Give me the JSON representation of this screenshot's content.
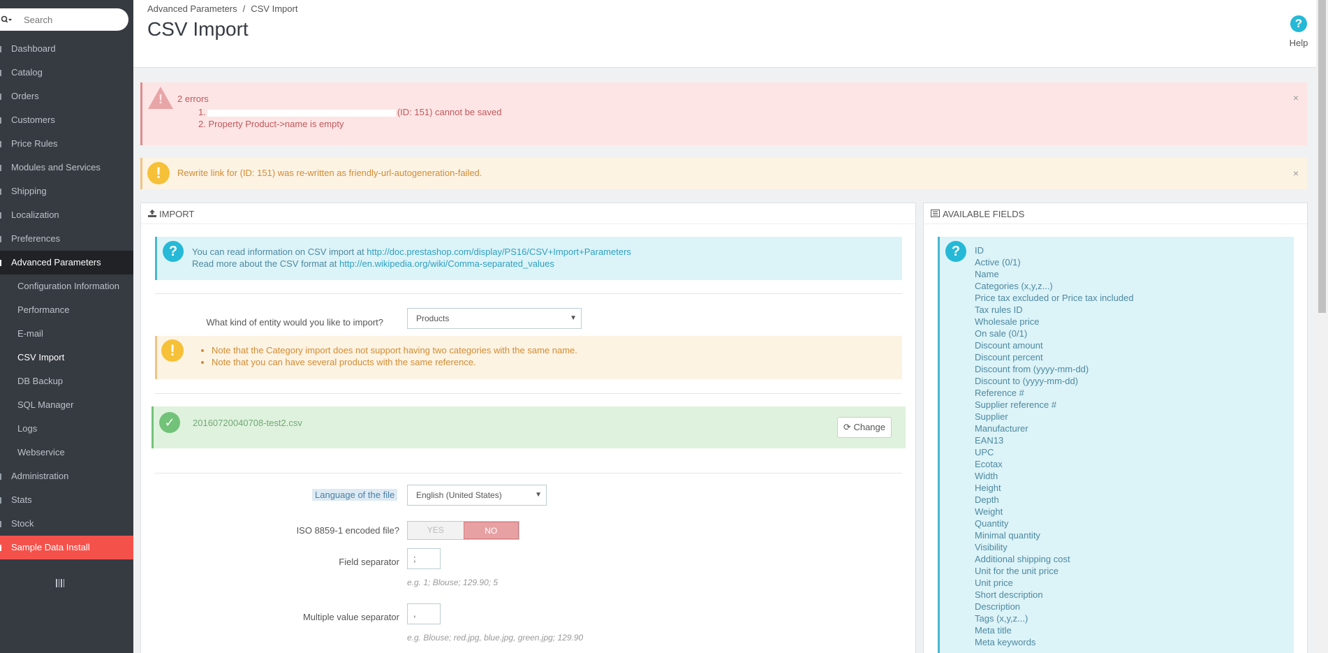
{
  "sidebar": {
    "search_placeholder": "Search",
    "items": [
      {
        "label": "Dashboard"
      },
      {
        "label": "Catalog"
      },
      {
        "label": "Orders"
      },
      {
        "label": "Customers"
      },
      {
        "label": "Price Rules"
      },
      {
        "label": "Modules and Services"
      },
      {
        "label": "Shipping"
      },
      {
        "label": "Localization"
      },
      {
        "label": "Preferences"
      },
      {
        "label": "Advanced Parameters"
      }
    ],
    "subitems": [
      {
        "label": "Configuration Information"
      },
      {
        "label": "Performance"
      },
      {
        "label": "E-mail"
      },
      {
        "label": "CSV Import"
      },
      {
        "label": "DB Backup"
      },
      {
        "label": "SQL Manager"
      },
      {
        "label": "Logs"
      },
      {
        "label": "Webservice"
      }
    ],
    "items_after": [
      {
        "label": "Administration"
      },
      {
        "label": "Stats"
      },
      {
        "label": "Stock"
      },
      {
        "label": "Sample Data Install"
      }
    ]
  },
  "header": {
    "breadcrumb": [
      "Advanced Parameters",
      "CSV Import"
    ],
    "breadcrumb_sep": "/",
    "title": "CSV Import",
    "help_label": "Help"
  },
  "alerts": {
    "danger": {
      "title": "2 errors",
      "item1_prefix": "1.",
      "item1_suffix": "(ID: 151) cannot be saved",
      "item2": "2. Property Product->name is empty"
    },
    "warning": {
      "text": "Rewrite link for (ID: 151) was re-written as friendly-url-autogeneration-failed."
    },
    "close_glyph": "×"
  },
  "import_panel": {
    "heading": "IMPORT",
    "info_line1": "You can read information on CSV import at ",
    "info_link1": "http://doc.prestashop.com/display/PS16/CSV+Import+Parameters",
    "info_line2": "Read more about the CSV format at ",
    "info_link2": "http://en.wikipedia.org/wiki/Comma-separated_values",
    "entity_label": "What kind of entity would you like to import?",
    "entity_value": "Products",
    "notes": [
      "Note that the Category import does not support having two categories with the same name.",
      "Note that you can have several products with the same reference."
    ],
    "file_name": "20160720040708-test2.csv",
    "change_label": "Change",
    "language_label": "Language of the file",
    "language_value": "English (United States)",
    "iso_label": "ISO 8859-1 encoded file?",
    "yes_label": "YES",
    "no_label": "NO",
    "field_sep_label": "Field separator",
    "field_sep_value": ";",
    "field_sep_hint": "e.g. 1; Blouse; 129.90; 5",
    "multi_sep_label": "Multiple value separator",
    "multi_sep_value": ",",
    "multi_sep_hint": "e.g. Blouse; red.jpg, blue.jpg, green.jpg; 129.90"
  },
  "fields_panel": {
    "heading": "AVAILABLE FIELDS",
    "fields": [
      "ID",
      "Active (0/1)",
      "Name",
      "Categories (x,y,z...)",
      "Price tax excluded or Price tax included",
      "Tax rules ID",
      "Wholesale price",
      "On sale (0/1)",
      "Discount amount",
      "Discount percent",
      "Discount from (yyyy-mm-dd)",
      "Discount to (yyyy-mm-dd)",
      "Reference #",
      "Supplier reference #",
      "Supplier",
      "Manufacturer",
      "EAN13",
      "UPC",
      "Ecotax",
      "Width",
      "Height",
      "Depth",
      "Weight",
      "Quantity",
      "Minimal quantity",
      "Visibility",
      "Additional shipping cost",
      "Unit for the unit price",
      "Unit price",
      "Short description",
      "Description",
      "Tags (x,y,z...)",
      "Meta title",
      "Meta keywords"
    ]
  },
  "colors": {
    "sidebar_bg": "#363a41",
    "accent_blue": "#25b9d7",
    "danger_bg": "#fde5e5",
    "warning_bg": "#fdf3e3",
    "success_bg": "#dff2dd",
    "sample_data_red": "#f5514b"
  }
}
